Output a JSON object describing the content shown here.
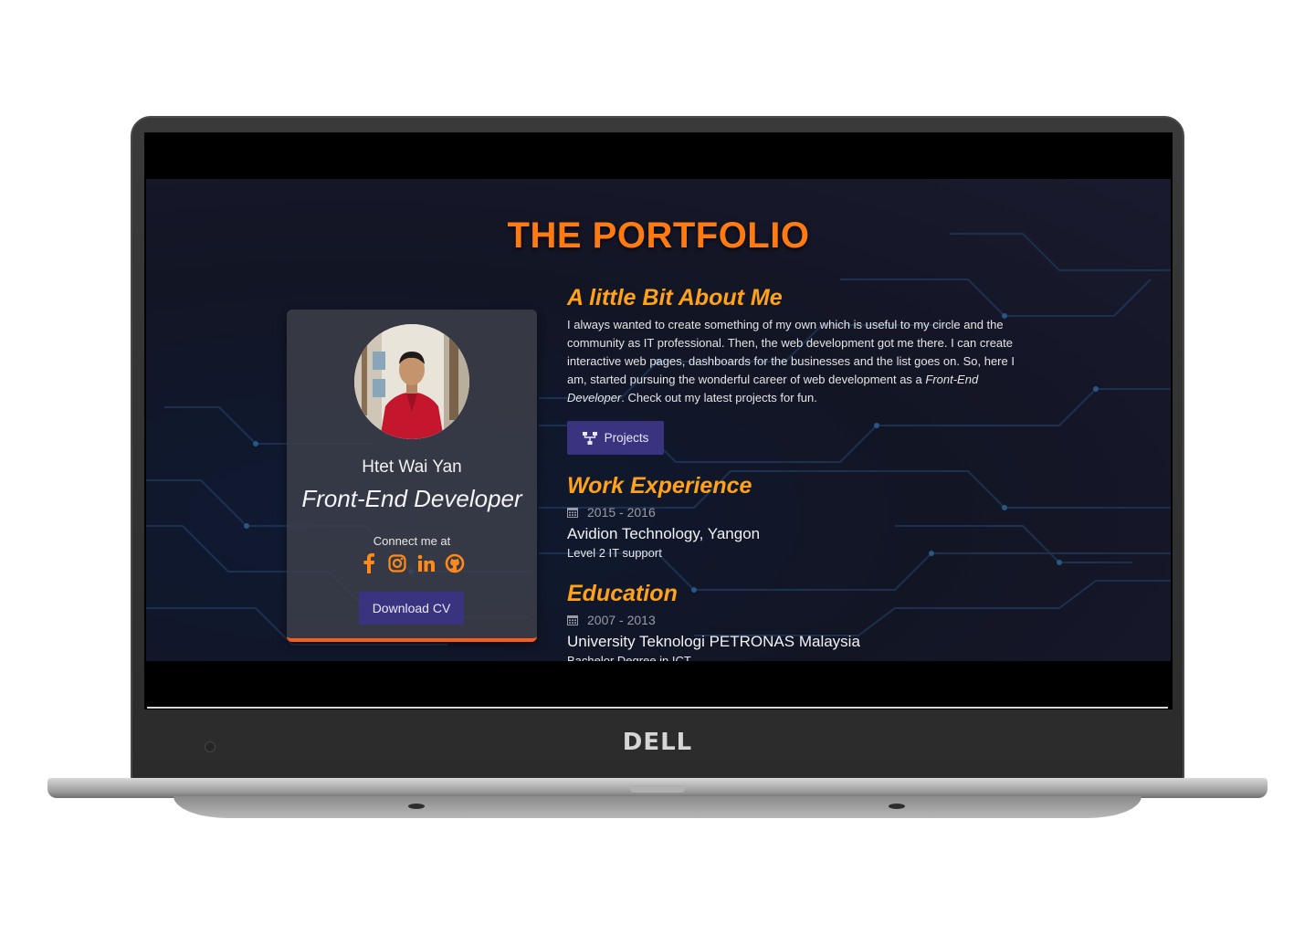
{
  "device": {
    "brand": "DELL"
  },
  "page": {
    "title": "THE PORTFOLIO"
  },
  "profile": {
    "name": "Htet Wai Yan",
    "role": "Front-End Developer",
    "connect_label": "Connect me at",
    "socials": [
      "facebook-icon",
      "instagram-icon",
      "linkedin-icon",
      "github-icon"
    ],
    "download_label": "Download CV"
  },
  "about": {
    "heading": "A little Bit About Me",
    "text_before": "I always wanted to create something of my own which is useful to my circle and the community as IT professional. Then, the web development got me there. I can create interactive web pages, dashboards for the businesses and the list goes on. So, here I am, started pursuing the wonderful career of web development as a ",
    "text_emphasis": "Front-End Developer",
    "text_after": ". Check out my latest projects for fun.",
    "projects_label": "Projects"
  },
  "work": {
    "heading": "Work Experience",
    "period": "2015 - 2016",
    "company": "Avidion Technology, Yangon",
    "position": "Level 2 IT support"
  },
  "education": {
    "heading": "Education",
    "period": "2007 - 2013",
    "school": "University Teknologi PETRONAS Malaysia",
    "degree": "Bachelor Degree in ICT"
  },
  "colors": {
    "title": "#ff7b11",
    "heading": "#ffa21a",
    "button": "#3a3380",
    "card_accent": "#ff5a1a",
    "icon": "#ff8a1c"
  }
}
